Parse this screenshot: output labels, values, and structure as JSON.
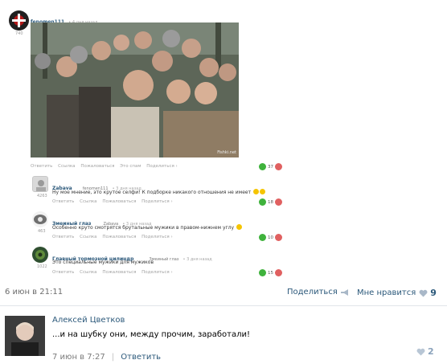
{
  "post": {
    "author": "fenomen111",
    "time": "4 дня назад",
    "avatar_id": "740",
    "image_caption": "Fishki.net",
    "actions": [
      "Ответить",
      "Ссылка",
      "Пожаловаться",
      "Это спам",
      "Поделиться ›"
    ],
    "likes": "37"
  },
  "comments": [
    {
      "author": "Zabava",
      "reply_to": "fenomen111",
      "time": "3 дня назад",
      "avatar_id": "4263",
      "text": "Ну мое мнение, это крутое селфи! К подборке никакого отношения не имеет",
      "actions": [
        "Ответить",
        "Ссылка",
        "Пожаловаться",
        "Поделиться ›"
      ],
      "likes": "18"
    },
    {
      "author": "Змеиный глаз",
      "reply_to": "Zabava",
      "time": "3 дня назад",
      "avatar_id": "463",
      "text": "Особенно круто смотрятся брутальные мужики в правом-нижнем углу",
      "actions": [
        "Ответить",
        "Ссылка",
        "Пожаловаться",
        "Поделиться ›"
      ],
      "likes": "10"
    },
    {
      "author": "Главный тормозной цилиндр",
      "reply_to": "Змеиный глаз",
      "time": "3 дня назад",
      "avatar_id": "1022",
      "text": "Это специальные мужики для мужиков",
      "actions": [
        "Ответить",
        "Ссылка",
        "Пожаловаться",
        "Поделиться ›"
      ],
      "likes": "15"
    }
  ],
  "footer": {
    "date": "6 июн в 21:11",
    "share_label": "Поделиться",
    "like_label": "Мне нравится",
    "like_count": "9"
  },
  "vk_comment": {
    "author": "Алексей Цветков",
    "text": "...и на шубку они, между прочим, заработали!",
    "date": "7 июн в 7:27",
    "separator": "|",
    "reply_label": "Ответить",
    "likes": "2"
  },
  "colors": {
    "link": "#2b587a",
    "like_green": "#3fb23c",
    "dislike_red": "#e06060"
  }
}
